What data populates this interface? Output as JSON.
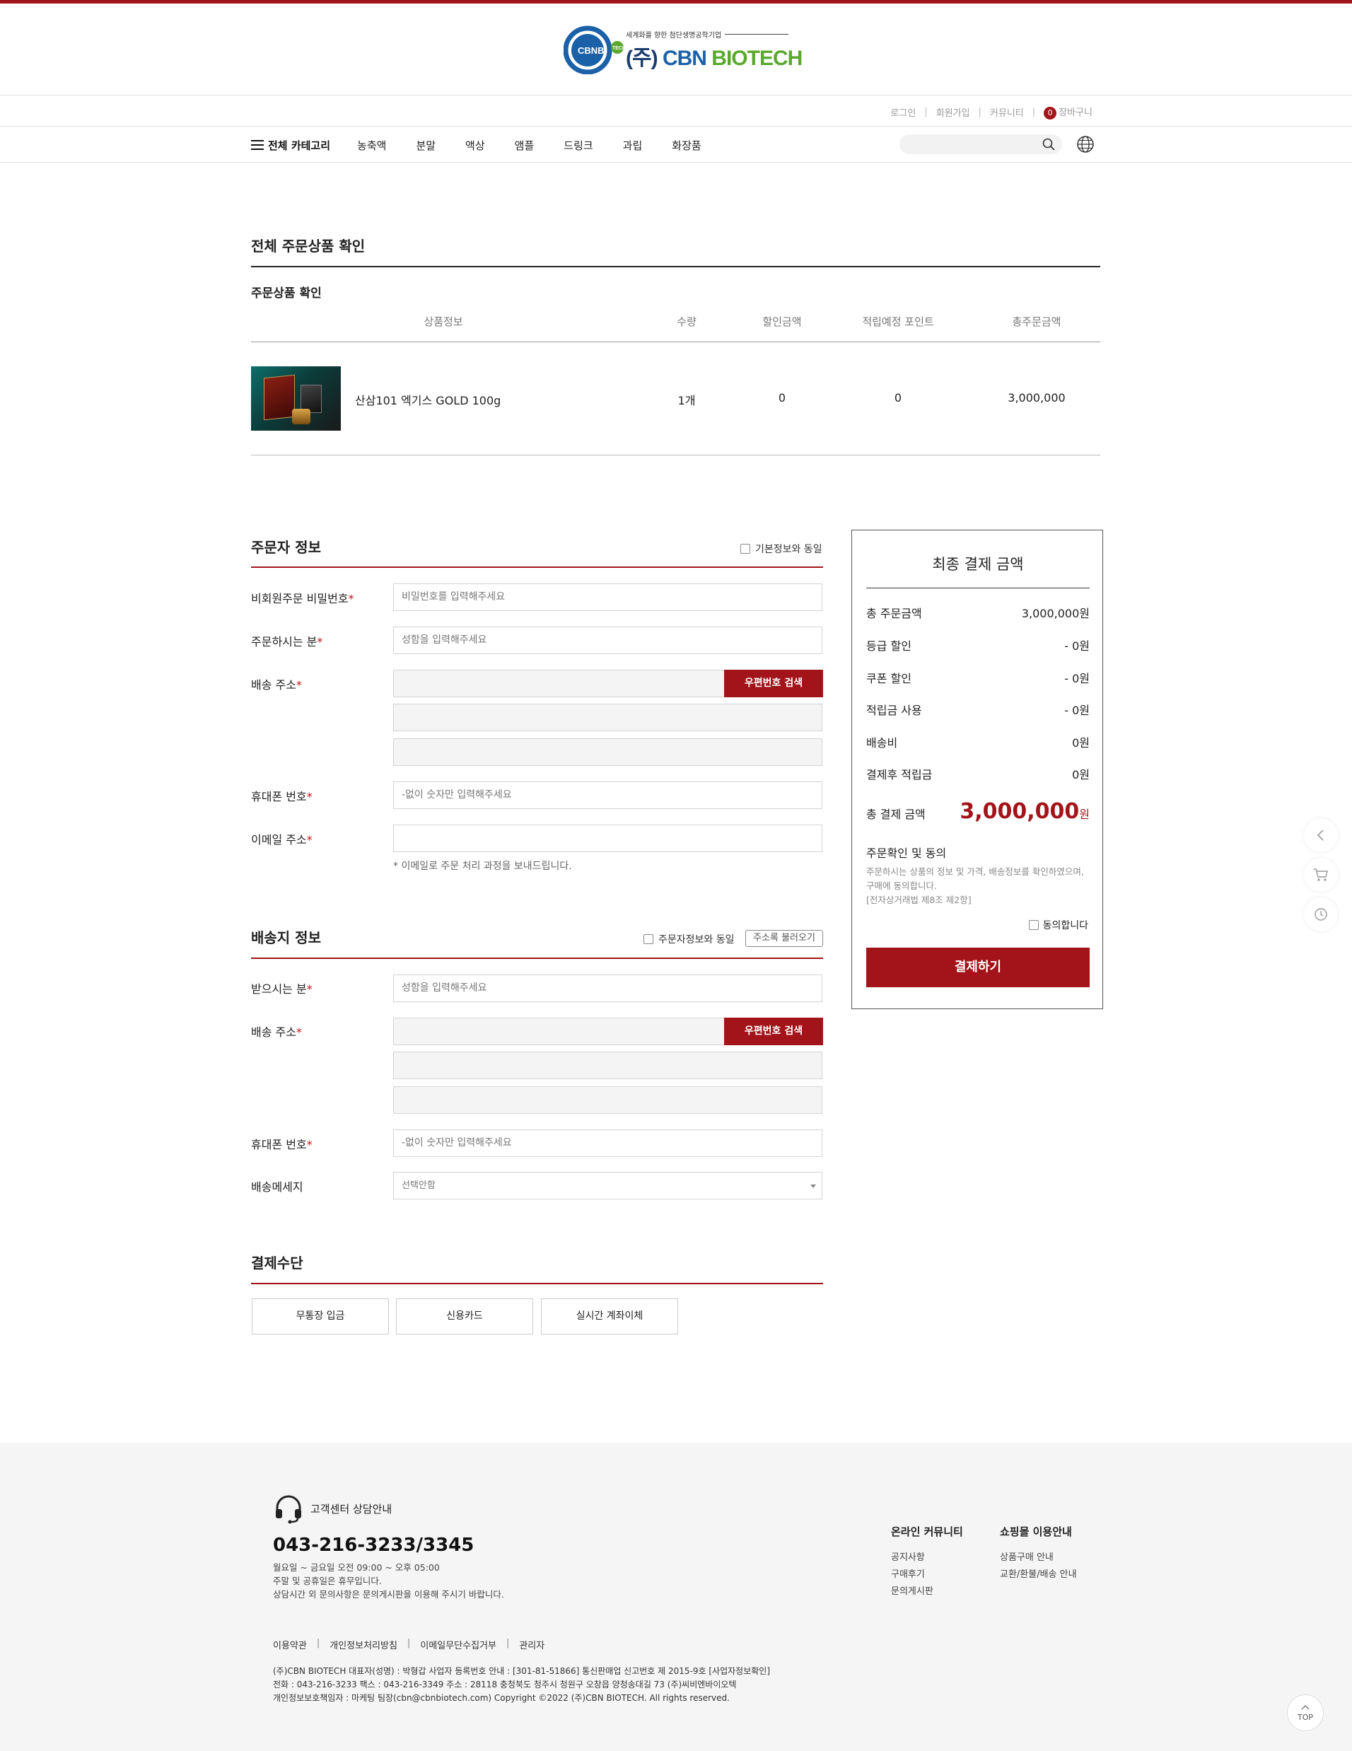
{
  "brand": {
    "slogan": "세계화를 향한 첨단생명공학기업",
    "logo_mark": "CBNBI",
    "logo_tag": "TECH",
    "logo_name_prefix": "(주)",
    "logo_name_1": "CBN",
    "logo_name_2": "BIOTECH",
    "accent_color": "#a3141a"
  },
  "util": {
    "login": "로그인",
    "join": "회원가입",
    "community": "커뮤니티",
    "cart_count": "0",
    "cart": "장바구니"
  },
  "nav": {
    "all_category": "전체 카테고리",
    "items": [
      "농축액",
      "분말",
      "액상",
      "앰플",
      "드링크",
      "과립",
      "화장품"
    ]
  },
  "search": {
    "placeholder": ""
  },
  "order": {
    "title": "전체 주문상품 확인",
    "subtitle": "주문상품 확인",
    "columns": [
      "상품정보",
      "수량",
      "할인금액",
      "적립예정 포인트",
      "총주문금액"
    ],
    "product": {
      "name": "산삼101 엑기스 GOLD 100g",
      "qty": "1개",
      "discount": "0",
      "points": "0",
      "total": "3,000,000"
    }
  },
  "orderer": {
    "title": "주문자 정보",
    "same_check": "기본정보와 동일",
    "pw_label": "비회원주문 비밀번호",
    "pw_placeholder": "비밀번호를 입력해주세요",
    "name_label": "주문하시는 분",
    "name_placeholder": "성함을 입력해주세요",
    "addr_label": "배송 주소",
    "zip_button": "우편번호 검색",
    "phone_label": "휴대폰 번호",
    "phone_placeholder": "-없이 숫자만 입력해주세요",
    "email_label": "이메일 주소",
    "email_note": "* 이메일로 주문 처리 과정을 보내드립니다.",
    "required": "*"
  },
  "shipping": {
    "title": "배송지 정보",
    "same_check": "주문자정보와 동일",
    "addrbook": "주소록 불러오기",
    "name_label": "받으시는 분",
    "name_placeholder": "성함을 입력해주세요",
    "addr_label": "배송 주소",
    "zip_button": "우편번호 검색",
    "phone_label": "휴대폰 번호",
    "phone_placeholder": "-없이 숫자만 입력해주세요",
    "msg_label": "배송메세지",
    "msg_selected": "선택안함"
  },
  "payment": {
    "title": "결제수단",
    "methods": [
      "무통장 입금",
      "신용카드",
      "실시간 계좌이체"
    ]
  },
  "summary": {
    "title": "최종 결제 금액",
    "rows": [
      {
        "label": "총 주문금액",
        "value": "3,000,000원"
      },
      {
        "label": "등급 할인",
        "value": "- 0원"
      },
      {
        "label": "쿠폰 할인",
        "value": "- 0원"
      },
      {
        "label": "적립금 사용",
        "value": "- 0원"
      },
      {
        "label": "배송비",
        "value": "0원"
      },
      {
        "label": "결제후 적립금",
        "value": "0원"
      }
    ],
    "total_label": "총 결제 금액",
    "total_value": "3,000,000",
    "total_unit": "원",
    "agree_title": "주문확인 및 동의",
    "agree_text_1": "주문하시는 상품의 정보 및 가격, 배송정보를 확인하였으며,",
    "agree_text_2": "구매에 동의합니다.",
    "agree_text_3": "[전자상거래법 제8조 제2항]",
    "agree_check": "동의합니다",
    "pay_button": "결제하기"
  },
  "footer": {
    "cs_title": "고객센터 상담안내",
    "phone": "043-216-3233/3345",
    "hours_1": "월요일 ~ 금요일 오전 09:00 ~ 오후 05:00",
    "hours_2": "주말 및 공휴일은 휴무입니다.",
    "hours_3": "상담시간 외 문의사항은 문의게시판을 이용해 주시기 바랍니다.",
    "community_title": "온라인 커뮤니티",
    "community_links": [
      "공지사항",
      "구매후기",
      "문의게시판"
    ],
    "guide_title": "쇼핑몰 이용안내",
    "guide_links": [
      "상품구매 안내",
      "교환/환불/배송 안내"
    ],
    "links": [
      "이용약관",
      "개인정보처리방침",
      "이메일무단수집거부",
      "관리자"
    ],
    "info_1": "(주)CBN BIOTECH   대표자(성명) : 박형갑   사업자 등록번호 안내 : [301-81-51866]   통신판매업 신고번호 제 2015-9호   [사업자정보확인]",
    "info_2": "전화 : 043-216-3233   팩스 : 043-216-3349   주소 : 28118 충청북도 청주시 청원구 오창읍 양청송대길 73 (주)씨비엔바이오텍",
    "info_3": "개인정보보호책임자 : 마케팅 팀장(cbn@cbnbiotech.com)   Copyright ©2022 (주)CBN BIOTECH. All rights reserved.",
    "top": "TOP"
  }
}
